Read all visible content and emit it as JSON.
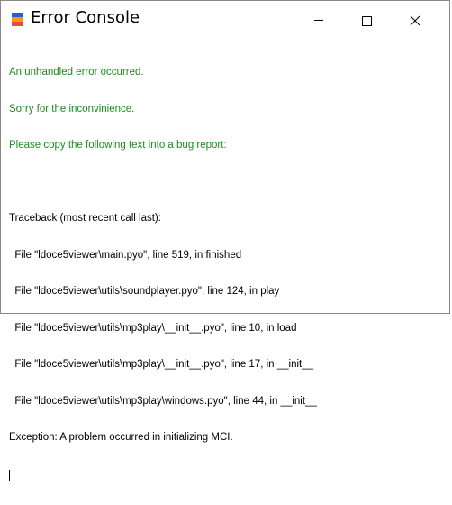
{
  "window": {
    "title": "Error Console"
  },
  "console": {
    "lines": [
      {
        "text": "An unhandled error occurred.",
        "color": "green"
      },
      {
        "text": "Sorry for the inconvinience.",
        "color": "green"
      },
      {
        "text": "Please copy the following text into a bug report:",
        "color": "green"
      },
      {
        "text": "",
        "color": "black"
      },
      {
        "text": "Traceback (most recent call last):",
        "color": "black"
      },
      {
        "text": "  File \"ldoce5viewer\\main.pyo\", line 519, in finished",
        "color": "black"
      },
      {
        "text": "  File \"ldoce5viewer\\utils\\soundplayer.pyo\", line 124, in play",
        "color": "black"
      },
      {
        "text": "  File \"ldoce5viewer\\utils\\mp3play\\__init__.pyo\", line 10, in load",
        "color": "black"
      },
      {
        "text": "  File \"ldoce5viewer\\utils\\mp3play\\__init__.pyo\", line 17, in __init__",
        "color": "black"
      },
      {
        "text": "  File \"ldoce5viewer\\utils\\mp3play\\windows.pyo\", line 44, in __init__",
        "color": "black"
      },
      {
        "text": "Exception: A problem occurred in initializing MCI.",
        "color": "black"
      }
    ]
  },
  "colors": {
    "green_text": "#1c8c1c",
    "black_text": "#000000"
  },
  "icons": {
    "app": "app-icon",
    "minimize": "minimize-icon",
    "maximize": "maximize-icon",
    "close": "close-icon"
  }
}
